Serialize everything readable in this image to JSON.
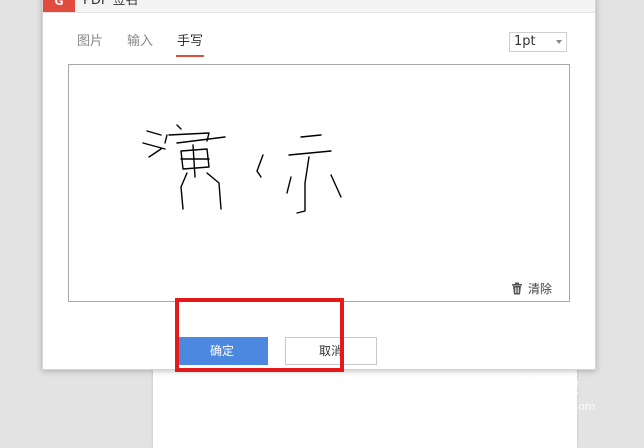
{
  "dialog": {
    "title": "PDF 签名",
    "tabs": [
      {
        "label": "图片",
        "active": false
      },
      {
        "label": "输入",
        "active": false
      },
      {
        "label": "手写",
        "active": true
      }
    ],
    "pen_size": "1pt",
    "clear_label": "清除",
    "ok_label": "确定",
    "cancel_label": "取消",
    "handwriting_text": "演示"
  },
  "colors": {
    "accent_red": "#e24c3f",
    "primary_button": "#4d88e0",
    "annotation_box": "#e41a1a"
  },
  "watermark": {
    "brand": "Bai 经验",
    "url": "jingyan.baidu.com"
  }
}
